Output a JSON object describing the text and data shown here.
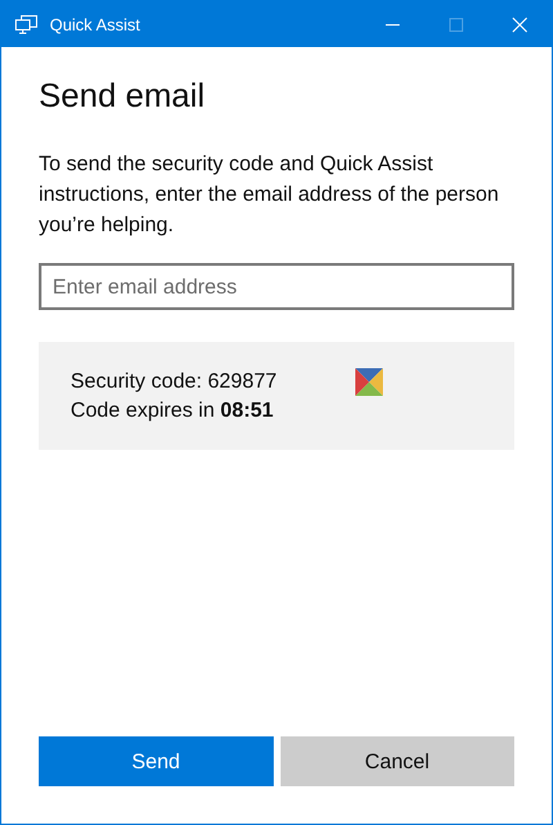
{
  "window": {
    "title": "Quick Assist",
    "maximize_disabled": true
  },
  "heading": "Send email",
  "instructions": "To send the security code and Quick Assist instructions, enter the email address of the person you’re helping.",
  "email_field": {
    "placeholder": "Enter email address"
  },
  "code_panel": {
    "security_code": "Security code: 629877",
    "expiry": "Code expires in **08:51**"
  },
  "buttons": [
    {
      "label": "Send",
      "kind": "primary"
    },
    {
      "label": "Cancel",
      "kind": "secondary"
    }
  ]
}
